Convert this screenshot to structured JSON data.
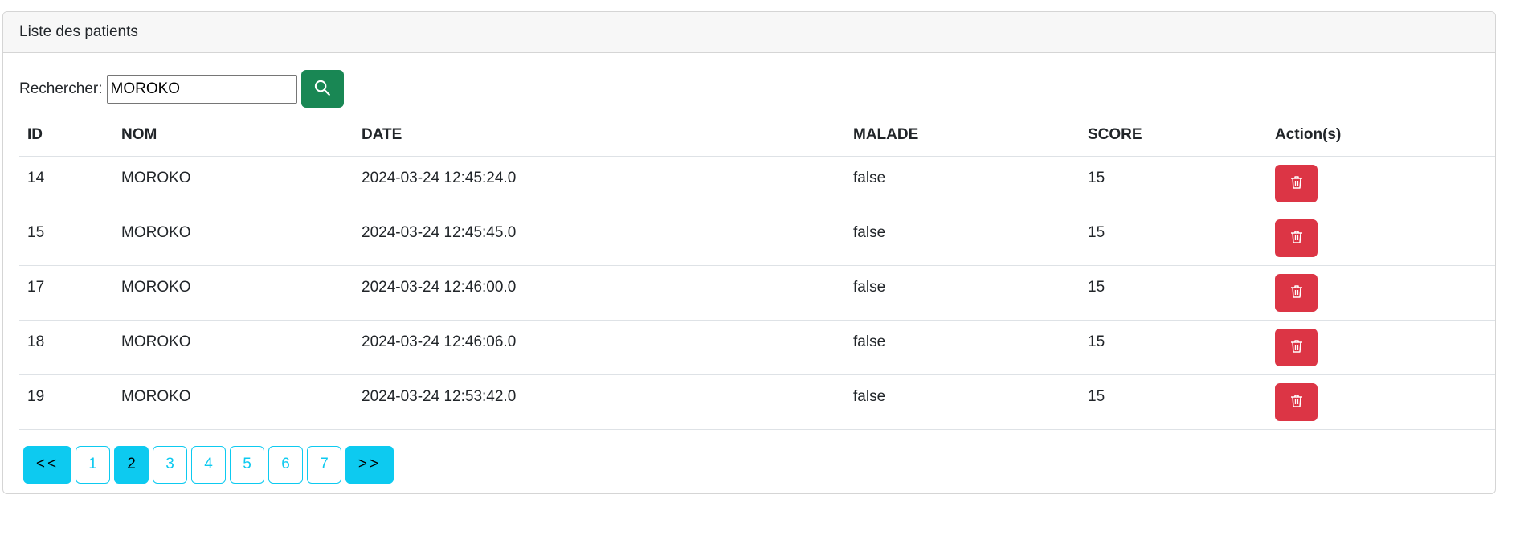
{
  "card": {
    "title": "Liste des patients"
  },
  "search": {
    "label": "Rechercher:",
    "value": "MOROKO",
    "placeholder": ""
  },
  "table": {
    "headers": {
      "id": "ID",
      "nom": "NOM",
      "date": "DATE",
      "malade": "MALADE",
      "score": "SCORE",
      "actions": "Action(s)"
    },
    "rows": [
      {
        "id": "14",
        "nom": "MOROKO",
        "date": "2024-03-24 12:45:24.0",
        "malade": "false",
        "score": "15"
      },
      {
        "id": "15",
        "nom": "MOROKO",
        "date": "2024-03-24 12:45:45.0",
        "malade": "false",
        "score": "15"
      },
      {
        "id": "17",
        "nom": "MOROKO",
        "date": "2024-03-24 12:46:00.0",
        "malade": "false",
        "score": "15"
      },
      {
        "id": "18",
        "nom": "MOROKO",
        "date": "2024-03-24 12:46:06.0",
        "malade": "false",
        "score": "15"
      },
      {
        "id": "19",
        "nom": "MOROKO",
        "date": "2024-03-24 12:53:42.0",
        "malade": "false",
        "score": "15"
      }
    ]
  },
  "pagination": {
    "prev_label": "<<",
    "next_label": ">>",
    "pages": [
      "1",
      "2",
      "3",
      "4",
      "5",
      "6",
      "7"
    ],
    "current": "2"
  },
  "colors": {
    "search_button": "#198754",
    "delete_button": "#dc3545",
    "pagination_accent": "#0dcaf0"
  },
  "icons": {
    "search": "search-icon",
    "delete": "trash-icon"
  }
}
